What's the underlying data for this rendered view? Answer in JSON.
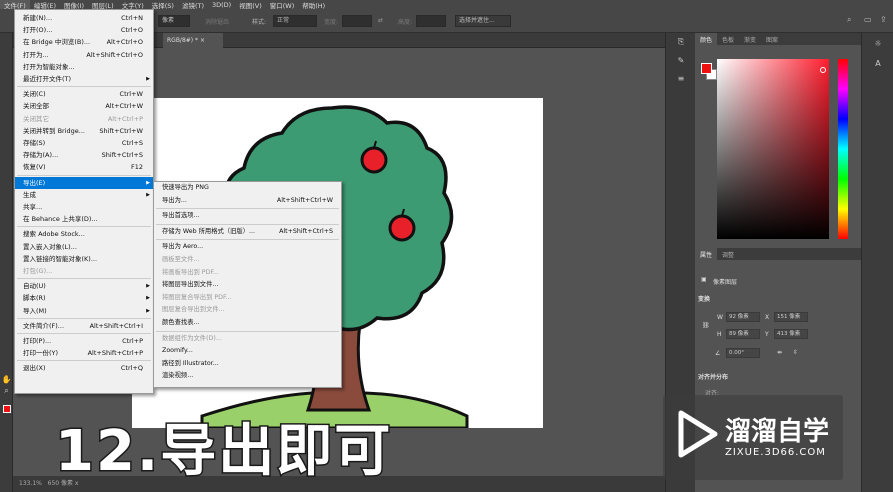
{
  "menubar": [
    "文件(F)",
    "编辑(E)",
    "图像(I)",
    "图层(L)",
    "文字(Y)",
    "选择(S)",
    "滤镜(T)",
    "3D(D)",
    "视图(V)",
    "窗口(W)",
    "帮助(H)"
  ],
  "options": {
    "unit": "像素",
    "antialias": "消除锯齿",
    "style_label": "样式:",
    "style_value": "正常",
    "width_label": "宽度:",
    "height_label": "高度:",
    "select_btn": "选择并遮住..."
  },
  "doc_tab": {
    "title": "RGB/8#) *",
    "close": "×"
  },
  "status": {
    "zoom": "133.1%",
    "info": "650 像素 x"
  },
  "file_menu": [
    {
      "l": "新建(N)...",
      "s": "Ctrl+N"
    },
    {
      "l": "打开(O)...",
      "s": "Ctrl+O"
    },
    {
      "l": "在 Bridge 中浏览(B)...",
      "s": "Alt+Ctrl+O"
    },
    {
      "l": "打开为...",
      "s": "Alt+Shift+Ctrl+O"
    },
    {
      "l": "打开为智能对象..."
    },
    {
      "l": "最近打开文件(T)",
      "arrow": true,
      "sep": true
    },
    {
      "l": "关闭(C)",
      "s": "Ctrl+W"
    },
    {
      "l": "关闭全部",
      "s": "Alt+Ctrl+W"
    },
    {
      "l": "关闭其它",
      "s": "Alt+Ctrl+P",
      "dis": true
    },
    {
      "l": "关闭并转到 Bridge...",
      "s": "Shift+Ctrl+W"
    },
    {
      "l": "存储(S)",
      "s": "Ctrl+S"
    },
    {
      "l": "存储为(A)...",
      "s": "Shift+Ctrl+S"
    },
    {
      "l": "恢复(V)",
      "s": "F12",
      "sep": true
    },
    {
      "l": "导出(E)",
      "arrow": true,
      "hl": true
    },
    {
      "l": "生成",
      "arrow": true
    },
    {
      "l": "共享..."
    },
    {
      "l": "在 Behance 上共享(D)...",
      "sep": true
    },
    {
      "l": "搜索 Adobe Stock..."
    },
    {
      "l": "置入嵌入对象(L)..."
    },
    {
      "l": "置入链接的智能对象(K)..."
    },
    {
      "l": "打包(G)...",
      "dis": true,
      "sep": true
    },
    {
      "l": "自动(U)",
      "arrow": true
    },
    {
      "l": "脚本(R)",
      "arrow": true
    },
    {
      "l": "导入(M)",
      "arrow": true,
      "sep": true
    },
    {
      "l": "文件简介(F)...",
      "s": "Alt+Shift+Ctrl+I",
      "sep": true
    },
    {
      "l": "打印(P)...",
      "s": "Ctrl+P"
    },
    {
      "l": "打印一份(Y)",
      "s": "Alt+Shift+Ctrl+P",
      "sep": true
    },
    {
      "l": "退出(X)",
      "s": "Ctrl+Q"
    }
  ],
  "export_menu": [
    {
      "l": "快速导出为 PNG"
    },
    {
      "l": "导出为...",
      "s": "Alt+Shift+Ctrl+W",
      "sep": true
    },
    {
      "l": "导出首选项...",
      "sep": true
    },
    {
      "l": "存储为 Web 所用格式（旧版）...",
      "s": "Alt+Shift+Ctrl+S",
      "sep": true
    },
    {
      "l": "导出为 Aero..."
    },
    {
      "l": "画板至文件...",
      "dis": true
    },
    {
      "l": "将画板导出到 PDF...",
      "dis": true
    },
    {
      "l": "将图层导出到文件..."
    },
    {
      "l": "将图层复合导出到 PDF...",
      "dis": true
    },
    {
      "l": "图层复合导出到文件...",
      "dis": true
    },
    {
      "l": "颜色查找表...",
      "sep": true
    },
    {
      "l": "数据组作为文件(D)...",
      "dis": true
    },
    {
      "l": "Zoomify..."
    },
    {
      "l": "路径到 Illustrator..."
    },
    {
      "l": "渲染视频..."
    }
  ],
  "color_panel": {
    "tabs": [
      "颜色",
      "色板",
      "渐变",
      "图案"
    ],
    "fg": "#e11",
    "bg": "#ffffff"
  },
  "properties": {
    "tabs": [
      "属性",
      "调整"
    ],
    "kind": "像素图层",
    "transform": "变换",
    "w_label": "W",
    "w_value": "92 像素",
    "x_label": "X",
    "x_value": "151 像素",
    "h_label": "H",
    "h_value": "89 像素",
    "y_label": "Y",
    "y_value": "413 像素",
    "angle": "0.00°",
    "align": "对齐并分布",
    "align_sub": "对齐:"
  },
  "caption": "12.导出即可",
  "logo": {
    "name": "溜溜自学",
    "url": "ZIXUE.3D66.COM"
  }
}
